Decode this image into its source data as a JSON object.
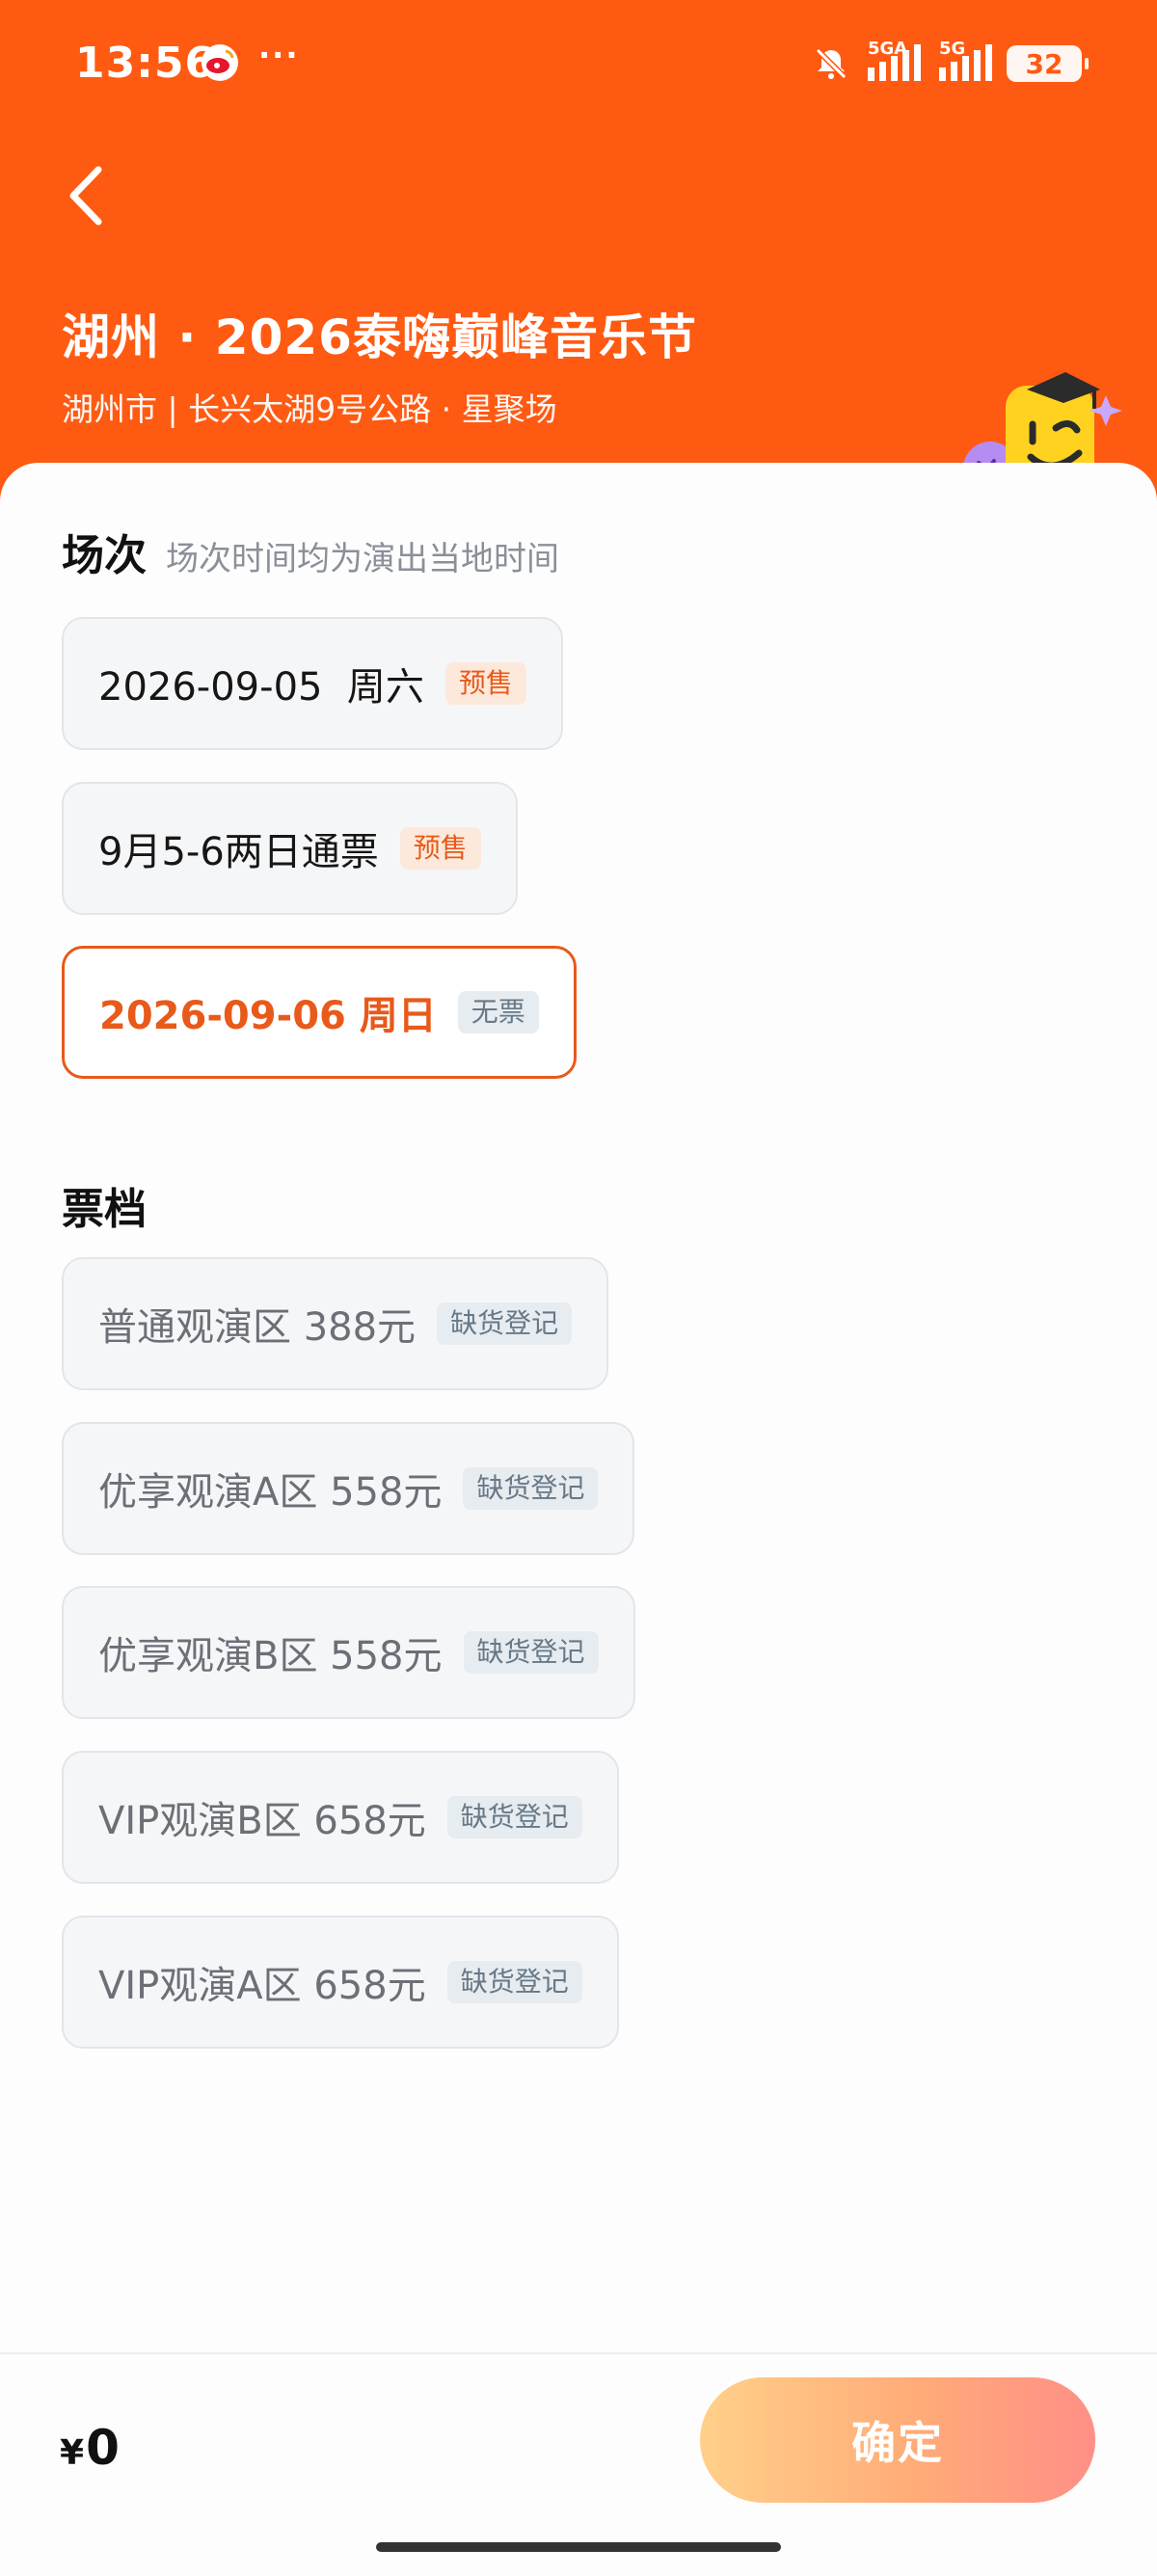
{
  "status": {
    "time": "13:56",
    "more": "···",
    "battery": "32",
    "signal1": "5GA",
    "signal2": "5G"
  },
  "header": {
    "title": "湖州 · 2026泰嗨巅峰音乐节",
    "subtitle": "湖州市 | 长兴太湖9号公路 · 星聚场"
  },
  "sessions": {
    "title": "场次",
    "note": "场次时间均为演出当地时间",
    "items": [
      {
        "label": "2026-09-05  周六",
        "tag": "预售",
        "selected": false
      },
      {
        "label": "9月5-6两日通票",
        "tag": "预售",
        "selected": false
      },
      {
        "label": "2026-09-06 周日",
        "tag": "无票",
        "selected": true
      }
    ]
  },
  "tickets": {
    "title": "票档",
    "items": [
      {
        "label": "普通观演区 388元",
        "tag": "缺货登记"
      },
      {
        "label": "优享观演A区 558元",
        "tag": "缺货登记"
      },
      {
        "label": "优享观演B区 558元",
        "tag": "缺货登记"
      },
      {
        "label": "VIP观演B区 658元",
        "tag": "缺货登记"
      },
      {
        "label": "VIP观演A区 658元",
        "tag": "缺货登记"
      }
    ]
  },
  "footer": {
    "currency": "¥",
    "price": "0",
    "confirm_label": "确定"
  },
  "colors": {
    "brand": "#ff5a12",
    "accent": "#e8591a",
    "presale_tag_bg": "#fde9dc",
    "none_tag_bg": "#e6ecf0"
  },
  "icons": [
    "weibo-icon",
    "mute-icon",
    "signal-icon",
    "battery-icon",
    "back-arrow-icon",
    "mascot-icon"
  ]
}
